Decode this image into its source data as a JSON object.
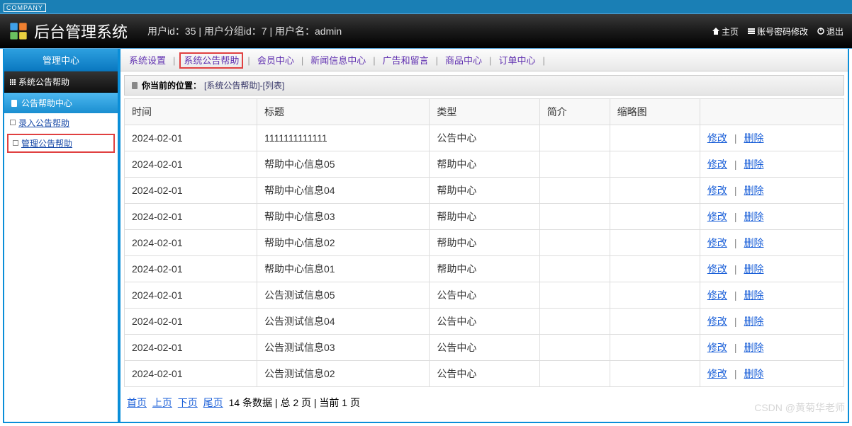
{
  "company_tag": "COMPANY",
  "header": {
    "title": "后台管理系统",
    "user_info": "用户id：35 | 用户分组id：7 | 用户名：admin",
    "links": {
      "home": "主页",
      "password": "账号密码修改",
      "logout": "退出"
    }
  },
  "sidebar": {
    "top": "管理中心",
    "black": "系统公告帮助",
    "blue": "公告帮助中心",
    "links": {
      "enter": "录入公告帮助",
      "manage": "管理公告帮助"
    }
  },
  "topnav": {
    "items": [
      "系统设置",
      "系统公告帮助",
      "会员中心",
      "新闻信息中心",
      "广告和留言",
      "商品中心",
      "订单中心"
    ],
    "active_index": 1
  },
  "breadcrumb": {
    "label": "你当前的位置：",
    "path": "[系统公告帮助]-[列表]"
  },
  "table": {
    "headers": [
      "时间",
      "标题",
      "类型",
      "简介",
      "缩略图",
      ""
    ],
    "actions": {
      "edit": "修改",
      "delete": "删除"
    },
    "rows": [
      {
        "time": "2024-02-01",
        "title": "1111111111111",
        "type": "公告中心",
        "intro": "",
        "thumb": ""
      },
      {
        "time": "2024-02-01",
        "title": "帮助中心信息05",
        "type": "帮助中心",
        "intro": "",
        "thumb": ""
      },
      {
        "time": "2024-02-01",
        "title": "帮助中心信息04",
        "type": "帮助中心",
        "intro": "",
        "thumb": ""
      },
      {
        "time": "2024-02-01",
        "title": "帮助中心信息03",
        "type": "帮助中心",
        "intro": "",
        "thumb": ""
      },
      {
        "time": "2024-02-01",
        "title": "帮助中心信息02",
        "type": "帮助中心",
        "intro": "",
        "thumb": ""
      },
      {
        "time": "2024-02-01",
        "title": "帮助中心信息01",
        "type": "帮助中心",
        "intro": "",
        "thumb": ""
      },
      {
        "time": "2024-02-01",
        "title": "公告测试信息05",
        "type": "公告中心",
        "intro": "",
        "thumb": ""
      },
      {
        "time": "2024-02-01",
        "title": "公告测试信息04",
        "type": "公告中心",
        "intro": "",
        "thumb": ""
      },
      {
        "time": "2024-02-01",
        "title": "公告测试信息03",
        "type": "公告中心",
        "intro": "",
        "thumb": ""
      },
      {
        "time": "2024-02-01",
        "title": "公告测试信息02",
        "type": "公告中心",
        "intro": "",
        "thumb": ""
      }
    ]
  },
  "pager": {
    "first": "首页",
    "prev": "上页",
    "next": "下页",
    "last": "尾页",
    "text": " 14 条数据 | 总 2 页 | 当前 1 页"
  },
  "watermark": "CSDN @黄菊华老师"
}
